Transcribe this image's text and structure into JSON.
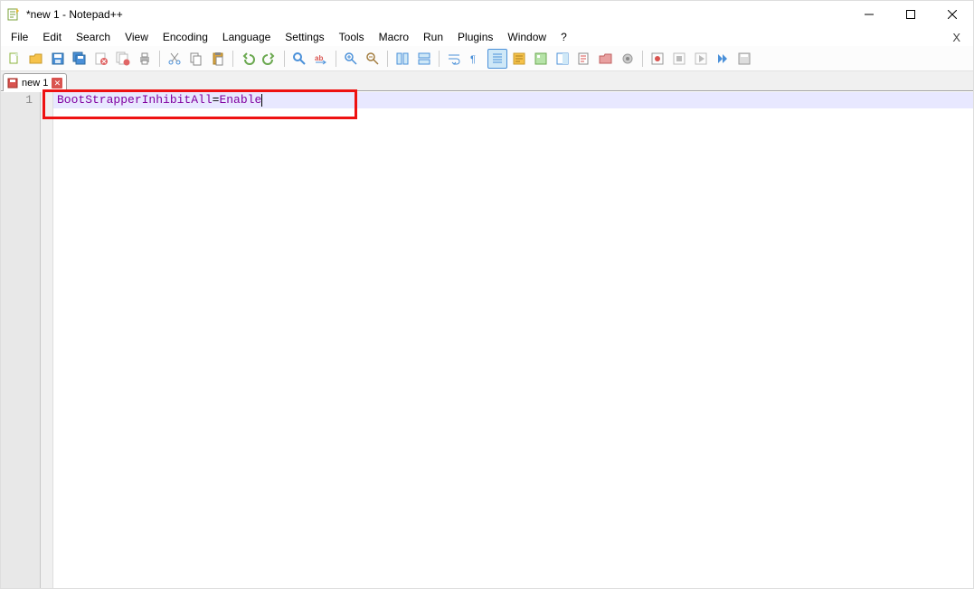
{
  "window": {
    "title": "*new 1 - Notepad++"
  },
  "menus": {
    "file": "File",
    "edit": "Edit",
    "search": "Search",
    "view": "View",
    "encoding": "Encoding",
    "language": "Language",
    "settings": "Settings",
    "tools": "Tools",
    "macro": "Macro",
    "run": "Run",
    "plugins": "Plugins",
    "window": "Window",
    "help": "?"
  },
  "tab": {
    "label": "new 1"
  },
  "editor": {
    "line_number": "1",
    "key": "BootStrapperInhibitAll",
    "eq": "=",
    "val": "Enable"
  }
}
